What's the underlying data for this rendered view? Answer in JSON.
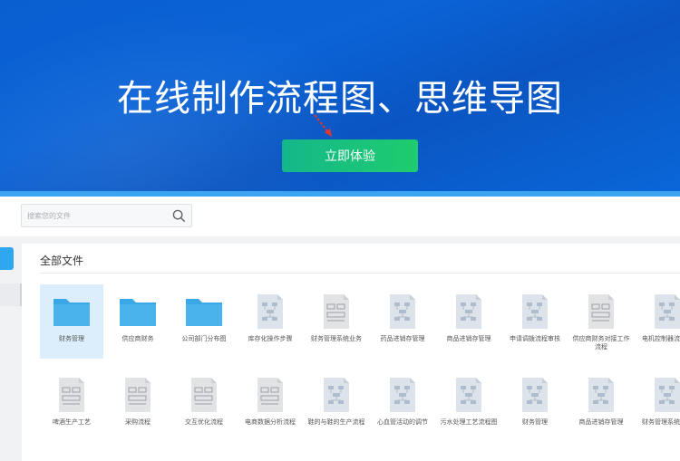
{
  "banner": {
    "title": "在线制作流程图、思维导图",
    "cta_label": "立即体验"
  },
  "search": {
    "placeholder": "搜索您的文件"
  },
  "panel": {
    "title": "全部文件"
  },
  "colors": {
    "banner": "#0b63d6",
    "cta": "#1fcc6e",
    "folder": "#4ab3ec",
    "selected": "#dceefb"
  },
  "files": [
    {
      "label": "财务管理",
      "type": "folder"
    },
    {
      "label": "供应商财务",
      "type": "folder"
    },
    {
      "label": "公司部门分布图",
      "type": "folder"
    },
    {
      "label": "库存化操作步骤",
      "type": "flow"
    },
    {
      "label": "财务管理系统业务",
      "type": "doc"
    },
    {
      "label": "药品进销存管理",
      "type": "flow"
    },
    {
      "label": "商品进销存管理",
      "type": "flow"
    },
    {
      "label": "申请调拨流程审核",
      "type": "flow"
    },
    {
      "label": "供应商财务对接工作流程",
      "type": "doc"
    },
    {
      "label": "电机控制器流程图",
      "type": "flow"
    },
    {
      "label": "啤酒生产工艺",
      "type": "doc"
    },
    {
      "label": "采购流程",
      "type": "doc"
    },
    {
      "label": "交互优化流程",
      "type": "doc"
    },
    {
      "label": "电商数据分析流程",
      "type": "doc"
    },
    {
      "label": "鞋的与鞋的生产流程",
      "type": "flow"
    },
    {
      "label": "心血管活动的调节",
      "type": "flow"
    },
    {
      "label": "污水处理工艺流程图",
      "type": "flow"
    },
    {
      "label": "财务管理",
      "type": "flow"
    },
    {
      "label": "商品进销存管理",
      "type": "flow"
    },
    {
      "label": "财务管理系统服务",
      "type": "flow"
    }
  ]
}
